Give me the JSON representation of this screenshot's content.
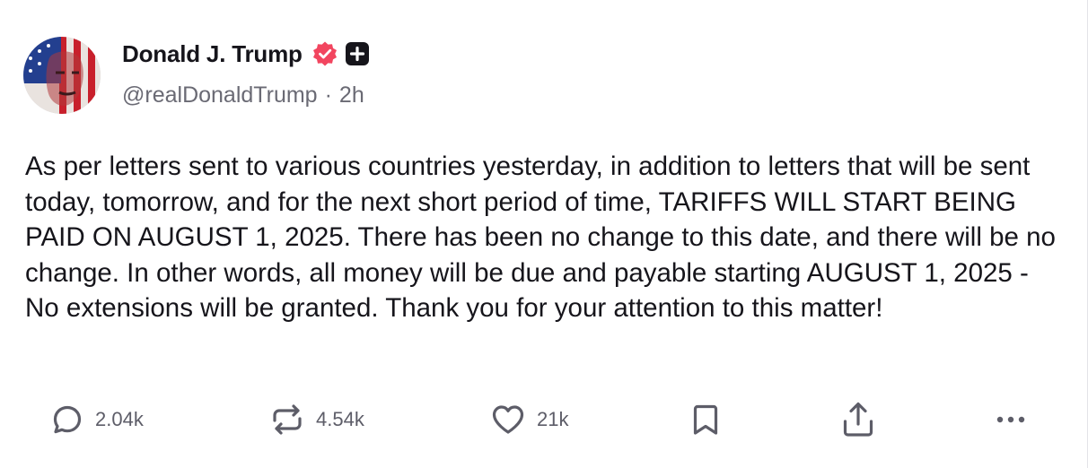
{
  "author": {
    "display_name": "Donald J. Trump",
    "handle": "@realDonaldTrump",
    "separator": "·",
    "time_ago": "2h",
    "verified_color": "#f2455f",
    "plus_badge_color": "#16151b",
    "avatar_icon": "avatar-image"
  },
  "post": {
    "text": "As per letters sent to various countries yesterday, in addition to letters that will be sent today, tomorrow, and for the next short period of time, TARIFFS WILL START BEING PAID ON AUGUST 1, 2025. There has been no change to this date, and there will be no change. In other words, all money will be due and payable starting AUGUST 1, 2025 - No extensions will be granted. Thank you for your attention to this matter!"
  },
  "actions": {
    "reply": {
      "icon": "reply-icon",
      "count": "2.04k"
    },
    "retruth": {
      "icon": "retruth-icon",
      "count": "4.54k"
    },
    "like": {
      "icon": "heart-icon",
      "count": "21k"
    },
    "bookmark": {
      "icon": "bookmark-icon"
    },
    "share": {
      "icon": "share-icon"
    },
    "more": {
      "icon": "more-icon"
    }
  },
  "colors": {
    "text": "#16151b",
    "muted": "#6a6a74",
    "icon": "#5d5d68"
  }
}
